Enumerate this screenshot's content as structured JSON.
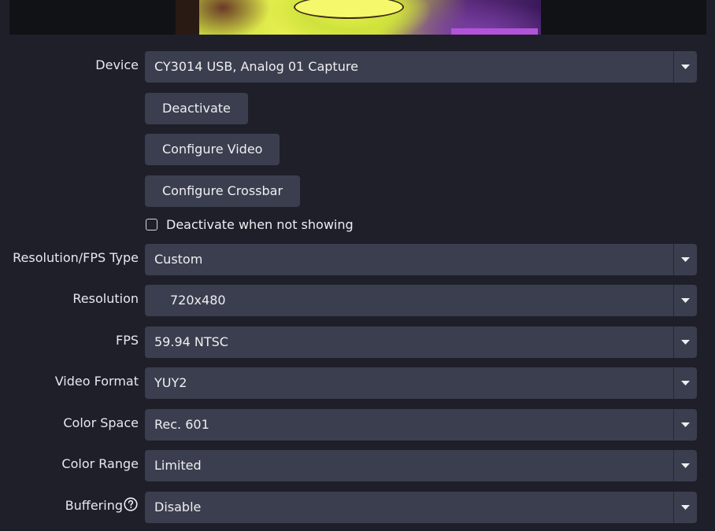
{
  "preview": {
    "description_icon": "video-preview"
  },
  "device": {
    "label": "Device",
    "value": "CY3014 USB, Analog 01 Capture"
  },
  "buttons": {
    "deactivate": "Deactivate",
    "configure_video": "Configure Video",
    "configure_crossbar": "Configure Crossbar"
  },
  "deactivate_when_not_showing": {
    "label": "Deactivate when not showing",
    "checked": false
  },
  "resolution_fps_type": {
    "label": "Resolution/FPS Type",
    "value": "Custom"
  },
  "resolution": {
    "label": "Resolution",
    "value": "720x480"
  },
  "fps": {
    "label": "FPS",
    "value": "59.94 NTSC"
  },
  "video_format": {
    "label": "Video Format",
    "value": "YUY2"
  },
  "color_space": {
    "label": "Color Space",
    "value": "Rec. 601"
  },
  "color_range": {
    "label": "Color Range",
    "value": "Limited"
  },
  "buffering": {
    "label": "Buffering",
    "value": "Disable",
    "help_icon": "question-circle-icon"
  },
  "colors": {
    "background": "#1e1f29",
    "control": "#3b3e4e",
    "text": "#eeeef2"
  }
}
